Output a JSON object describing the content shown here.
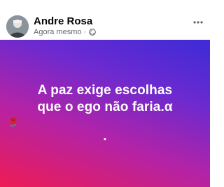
{
  "post": {
    "author": {
      "name": "Andre Rosa",
      "avatar_icon": "profile-photo"
    },
    "meta": {
      "time": "Agora mesmo",
      "separator": "·",
      "audience_icon": "globe-icon"
    },
    "menu_icon": "more-options-icon",
    "content": {
      "line1": "A paz exige escolhas",
      "line2_text": "que o ego não faria.α",
      "line2_emoji": "rose-icon",
      "line2_end": ".",
      "colors": {
        "gradient_start": "#3d2bd6",
        "gradient_mid": "#b423a6",
        "gradient_end": "#ee1b53",
        "text": "#ffffff"
      }
    }
  }
}
